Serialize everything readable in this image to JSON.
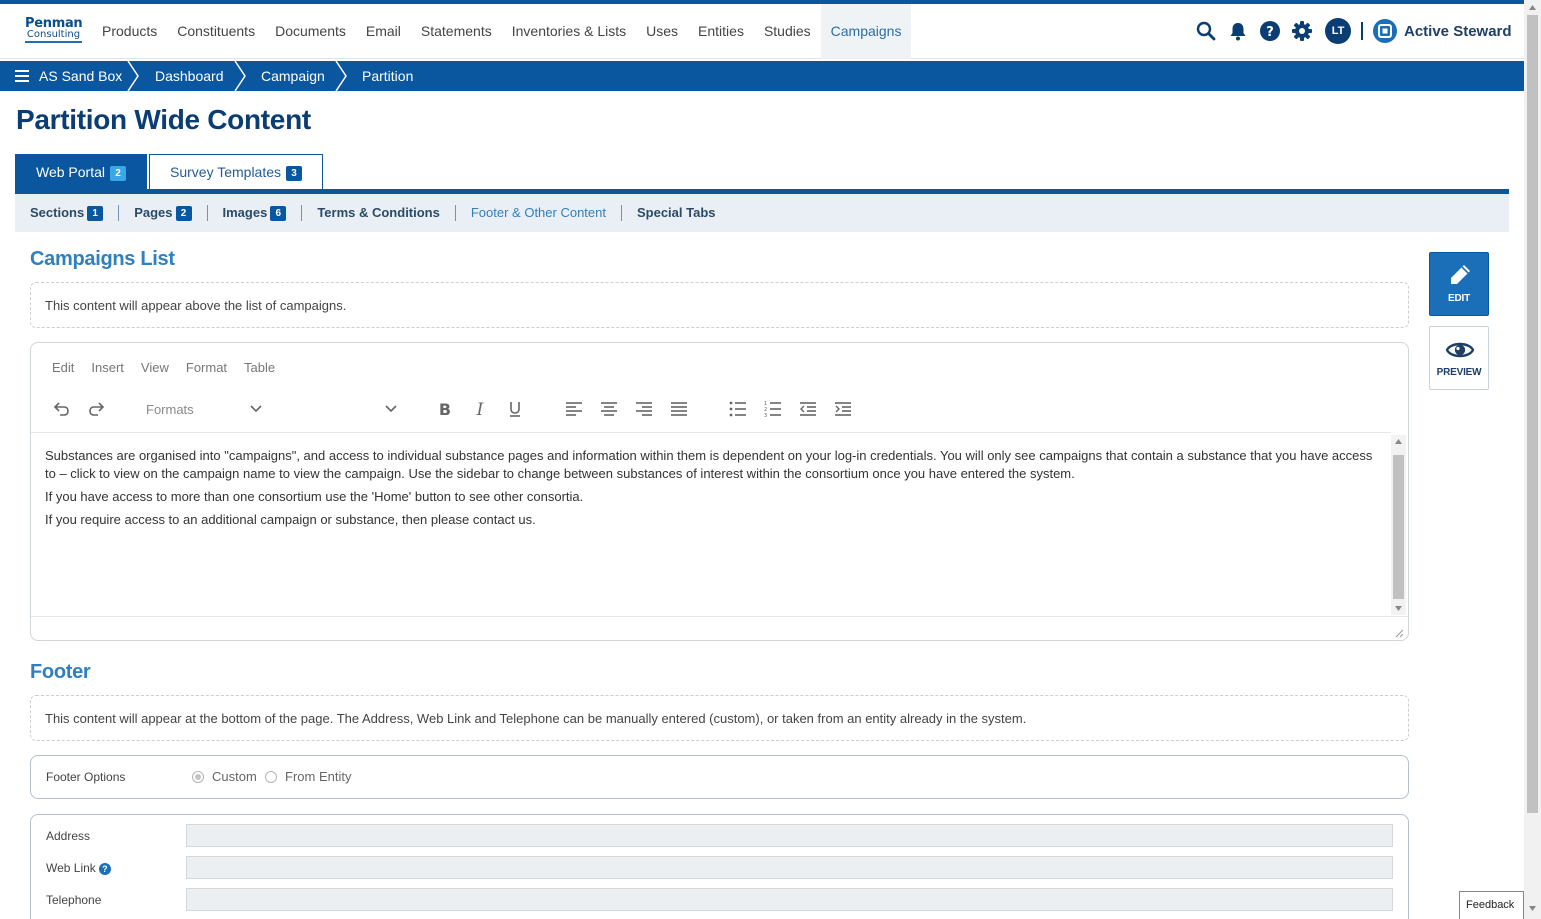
{
  "logo": {
    "line1": "Penman",
    "line2": "Consulting"
  },
  "nav": {
    "items": [
      "Products",
      "Constituents",
      "Documents",
      "Email",
      "Statements",
      "Inventories & Lists",
      "Uses",
      "Entities",
      "Studies",
      "Campaigns"
    ],
    "active": "Campaigns",
    "user_initials": "LT",
    "brand": "Active Steward"
  },
  "breadcrumb": [
    "AS Sand Box",
    "Dashboard",
    "Campaign",
    "Partition"
  ],
  "page_title": "Partition Wide Content",
  "tabs": [
    {
      "label": "Web Portal",
      "count": "2"
    },
    {
      "label": "Survey Templates",
      "count": "3"
    }
  ],
  "subtabs": [
    {
      "label": "Sections",
      "count": "1"
    },
    {
      "label": "Pages",
      "count": "2"
    },
    {
      "label": "Images",
      "count": "6"
    },
    {
      "label": "Terms & Conditions"
    },
    {
      "label": "Footer & Other Content"
    },
    {
      "label": "Special Tabs"
    }
  ],
  "campaigns_list": {
    "heading": "Campaigns List",
    "hint": "This content will appear above the list of campaigns."
  },
  "editor": {
    "menu": [
      "Edit",
      "Insert",
      "View",
      "Format",
      "Table"
    ],
    "formats_label": "Formats",
    "paragraphs": [
      "Substances are organised into \"campaigns\", and access to individual substance pages and information within them is dependent on your log-in credentials. You will only see campaigns that contain a substance that you have access to – click to view on the campaign name to view the campaign. Use the sidebar to change between substances of interest within the consortium once you have entered the system.",
      "If you have access to more than one consortium use the 'Home' button to see other consortia.",
      "If you require access to an additional campaign or substance, then please contact us."
    ]
  },
  "actions": {
    "edit": "EDIT",
    "preview": "PREVIEW"
  },
  "footer": {
    "heading": "Footer",
    "hint": "This content will appear at the bottom of the page. The Address, Web Link and Telephone can be manually entered (custom), or taken from an entity already in the system.",
    "options_label": "Footer Options",
    "options": [
      "Custom",
      "From Entity"
    ],
    "selected": "Custom",
    "fields": [
      {
        "label": "Address",
        "value": ""
      },
      {
        "label": "Web Link",
        "value": ""
      },
      {
        "label": "Telephone",
        "value": ""
      }
    ]
  },
  "feedback_label": "Feedback",
  "colors": {
    "primary": "#0a57a0",
    "accent": "#2f80c0",
    "title": "#0a3d73"
  }
}
